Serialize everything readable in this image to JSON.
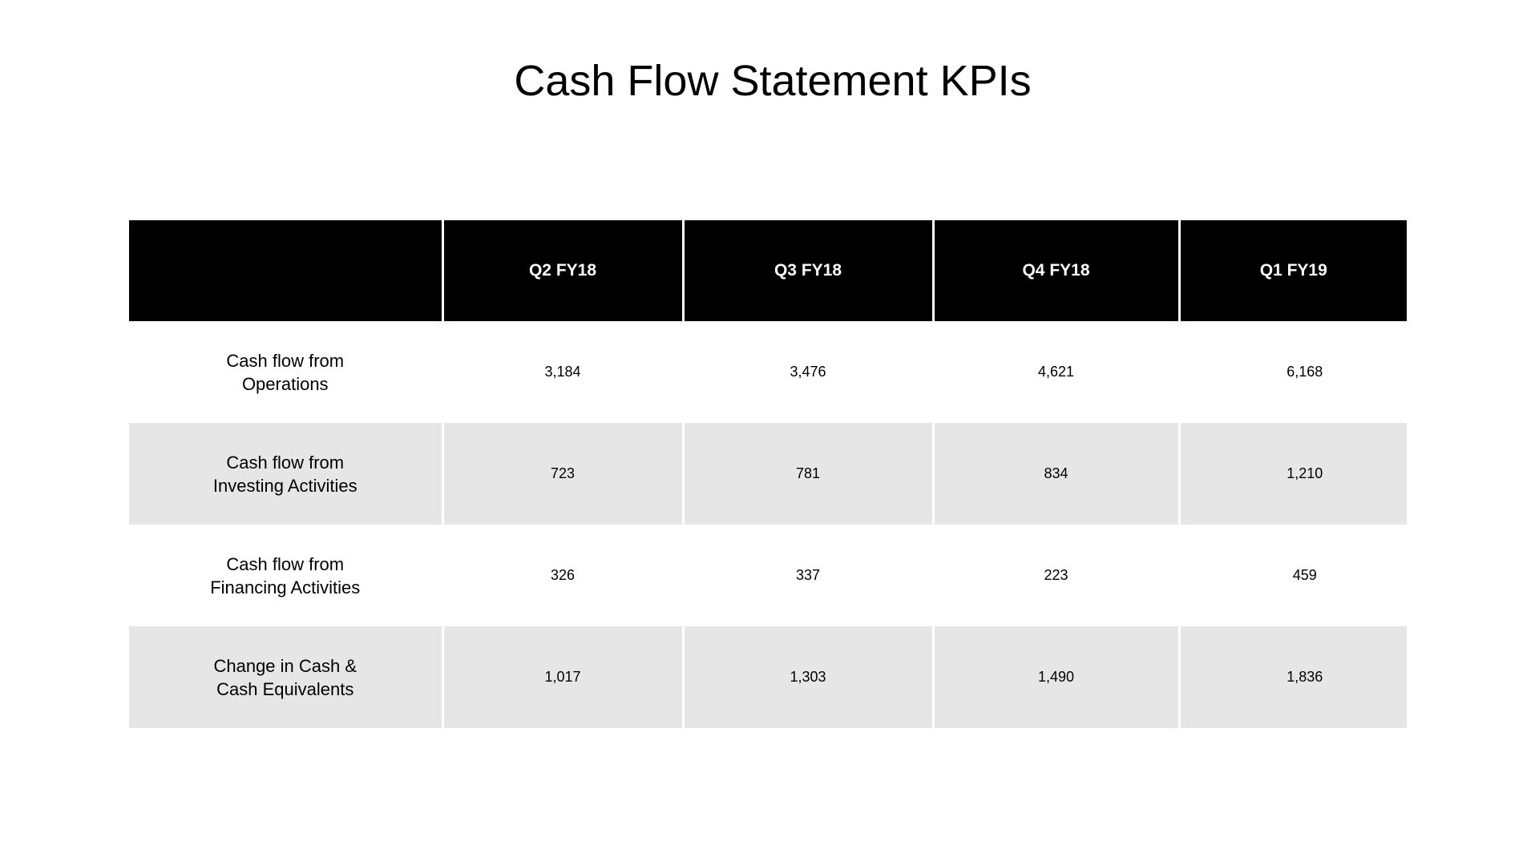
{
  "title": "Cash Flow Statement KPIs",
  "table": {
    "corner_header": "",
    "columns": [
      "Q2 FY18",
      "Q3 FY18",
      "Q4 FY18",
      "Q1 FY19"
    ],
    "rows": [
      {
        "label_line1": "Cash flow from",
        "label_line2": "Operations",
        "values": [
          "3,184",
          "3,476",
          "4,621",
          "6,168"
        ]
      },
      {
        "label_line1": "Cash flow from",
        "label_line2": "Investing Activities",
        "values": [
          "723",
          "781",
          "834",
          "1,210"
        ]
      },
      {
        "label_line1": "Cash flow from",
        "label_line2": "Financing Activities",
        "values": [
          "326",
          "337",
          "223",
          "459"
        ]
      },
      {
        "label_line1": "Change in Cash &",
        "label_line2": "Cash Equivalents",
        "values": [
          "1,017",
          "1,303",
          "1,490",
          "1,836"
        ]
      }
    ]
  },
  "colors": {
    "header_bg": "#000000",
    "header_text": "#ffffff",
    "alt_row_bg": "#e6e6e6",
    "row_bg": "#ffffff"
  }
}
